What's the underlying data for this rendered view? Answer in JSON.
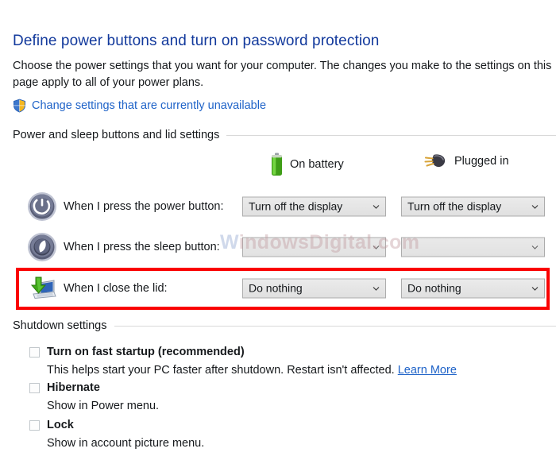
{
  "header": {
    "title": "Define power buttons and turn on password protection",
    "intro": "Choose the power settings that you want for your computer. The changes you make to the settings on this page apply to all of your power plans.",
    "uac_link": "Change settings that are currently unavailable",
    "uac_icon": "shield-icon"
  },
  "groups": {
    "power_and_sleep": "Power and sleep buttons and lid settings",
    "shutdown": "Shutdown settings"
  },
  "columns": [
    {
      "label": "On battery",
      "icon": "battery-icon"
    },
    {
      "label": "Plugged in",
      "icon": "plug-icon"
    }
  ],
  "rows": [
    {
      "id": "power",
      "icon": "power-button-icon",
      "label": "When I press the power button:",
      "battery_value": "Turn off the display",
      "plugged_value": "Turn off the display",
      "disabled": false,
      "highlighted": false
    },
    {
      "id": "sleep",
      "icon": "sleep-moon-icon",
      "label": "When I press the sleep button:",
      "battery_value": "",
      "plugged_value": "",
      "disabled": true,
      "highlighted": false
    },
    {
      "id": "lid",
      "icon": "laptop-close-lid-icon",
      "label": "When I close the lid:",
      "battery_value": "Do nothing",
      "plugged_value": "Do nothing",
      "disabled": false,
      "highlighted": true
    }
  ],
  "shutdown_items": [
    {
      "id": "fast-startup",
      "title": "Turn on fast startup (recommended)",
      "description": "This helps start your PC faster after shutdown. Restart isn't affected.",
      "link": "Learn More",
      "checked": false
    },
    {
      "id": "hibernate",
      "title": "Hibernate",
      "description": "Show in Power menu.",
      "link": "",
      "checked": false
    },
    {
      "id": "lock",
      "title": "Lock",
      "description": "Show in account picture menu.",
      "link": "",
      "checked": false
    }
  ],
  "watermark": {
    "prefix": "W",
    "text": "indowsDigital.com"
  },
  "colors": {
    "title_blue": "#12399c",
    "link_blue": "#1f63c8",
    "highlight_red": "#fa0202",
    "battery_green": "#4caf1f",
    "rule_grey": "#d9d9d9"
  }
}
